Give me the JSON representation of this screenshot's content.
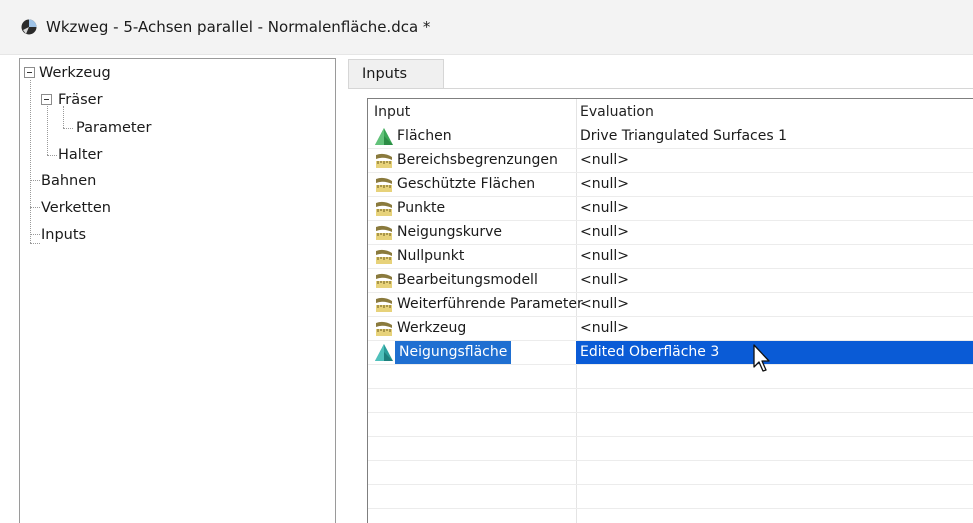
{
  "window": {
    "title": "Wkzweg - 5-Achsen parallel - Normalenfläche.dca *"
  },
  "tree": {
    "nodes": [
      {
        "label": "Werkzeug"
      },
      {
        "label": "Fräser"
      },
      {
        "label": "Parameter"
      },
      {
        "label": "Halter"
      },
      {
        "label": "Bahnen"
      },
      {
        "label": "Verketten"
      },
      {
        "label": "Inputs"
      }
    ]
  },
  "tabs": [
    {
      "label": "Inputs"
    }
  ],
  "grid": {
    "headers": {
      "input": "Input",
      "evaluation": "Evaluation"
    },
    "rows": [
      {
        "input": "Flächen",
        "evaluation": "Drive Triangulated Surfaces 1",
        "icon": "surface-triangle-green-icon"
      },
      {
        "input": "Bereichsbegrenzungen",
        "evaluation": "<null>",
        "icon": "curve-ruler-icon"
      },
      {
        "input": "Geschützte Flächen",
        "evaluation": "<null>",
        "icon": "curve-ruler-icon"
      },
      {
        "input": "Punkte",
        "evaluation": "<null>",
        "icon": "curve-ruler-icon"
      },
      {
        "input": "Neigungskurve",
        "evaluation": "<null>",
        "icon": "curve-ruler-icon"
      },
      {
        "input": "Nullpunkt",
        "evaluation": "<null>",
        "icon": "curve-ruler-icon"
      },
      {
        "input": "Bearbeitungsmodell",
        "evaluation": "<null>",
        "icon": "curve-ruler-icon"
      },
      {
        "input": "Weiterführende Parameter",
        "evaluation": "<null>",
        "icon": "curve-ruler-icon"
      },
      {
        "input": "Werkzeug",
        "evaluation": "<null>",
        "icon": "curve-ruler-icon"
      },
      {
        "input": "Neigungsfläche",
        "evaluation": "Edited Oberfläche 3",
        "icon": "surface-triangle-teal-icon",
        "selected": true
      }
    ]
  },
  "colors": {
    "selection": "#0a5bd6",
    "tree_border": "#9a9a9a"
  }
}
